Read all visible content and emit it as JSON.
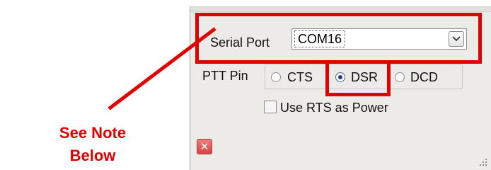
{
  "serial_port": {
    "label": "Serial Port",
    "value": "COM16",
    "dropdown_icon": "chevron-down-icon"
  },
  "ptt_pin": {
    "label": "PTT Pin",
    "options": [
      {
        "label": "CTS",
        "checked": false
      },
      {
        "label": "DSR",
        "checked": true
      },
      {
        "label": "DCD",
        "checked": false
      }
    ]
  },
  "rts_power": {
    "label": "Use RTS as Power",
    "checked": false
  },
  "close_button": {
    "icon": "close-icon",
    "glyph": "✕"
  },
  "annotation": {
    "line1": "See Note",
    "line2": "Below",
    "color": "#e00000"
  }
}
